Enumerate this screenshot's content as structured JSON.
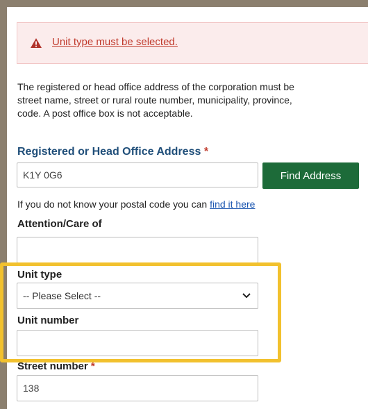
{
  "alert": {
    "icon": "warning-triangle-icon",
    "message": "Unit type must be selected.",
    "color": "#c0392b"
  },
  "intro": {
    "line1": "The registered or head office address of the corporation must be",
    "line2": "street name, street or rural route number, municipality, province,",
    "line3": "code. A post office box is not acceptable."
  },
  "address": {
    "title": "Registered or Head Office Address",
    "required_mark": "*",
    "postal_value": "K1Y 0G6",
    "find_button": "Find Address",
    "hint_text": "If you do not know your postal code you can ",
    "hint_link": "find it here"
  },
  "fields": {
    "attention_label": "Attention/Care of",
    "attention_value": "",
    "unit_type_label": "Unit type",
    "unit_type_selected": "-- Please Select --",
    "unit_number_label": "Unit number",
    "unit_number_value": "",
    "street_number_label": "Street number",
    "street_number_required": "*",
    "street_number_value": "138"
  },
  "colors": {
    "accent_green": "#1d6b39",
    "highlight": "#f2c12e",
    "heading_blue": "#1f4e79"
  }
}
